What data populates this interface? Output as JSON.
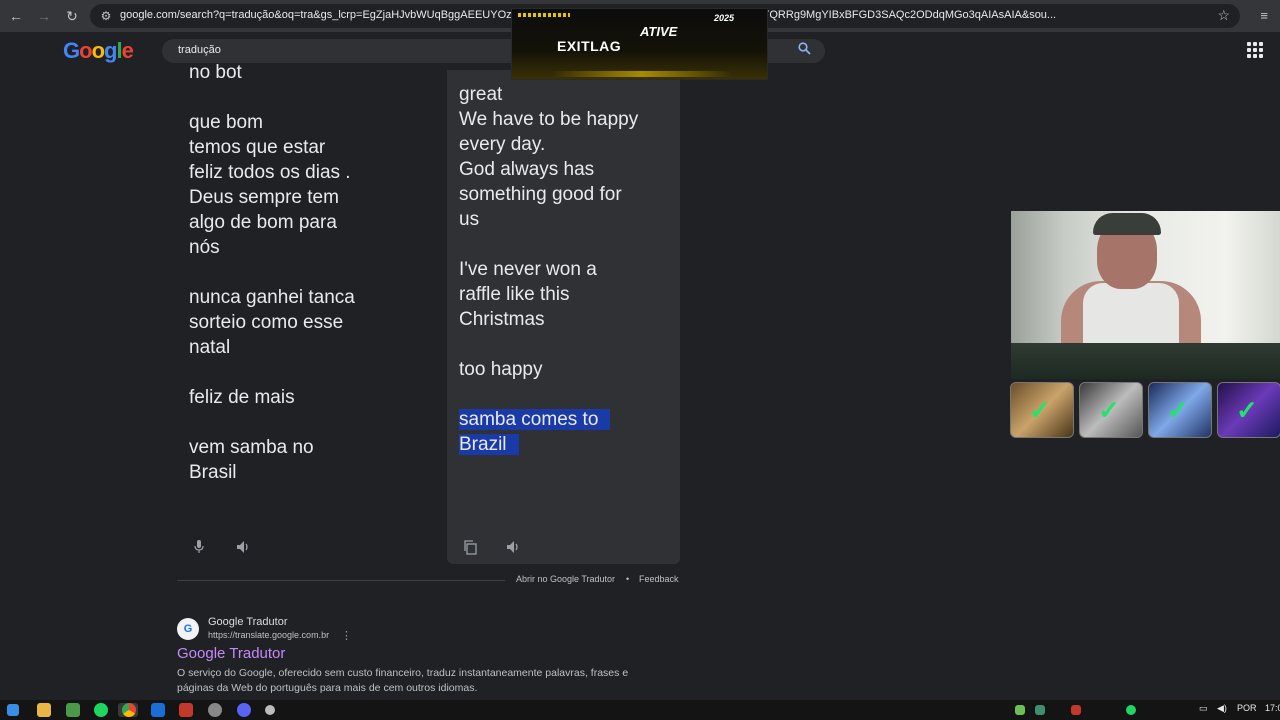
{
  "browser": {
    "url": "google.com/search?q=tradução&oq=tra&gs_lcrp=EgZjaHJvbWUqBggAEEUYOzIGCAEQRRg5MgYIBBBFGDsyBggFEEUYPDIGCAYQRRg9MgYIBxBFGD3SAQc2ODdqMGo3qAIAsAIA&sou..."
  },
  "google": {
    "logo_letters": [
      "G",
      "o",
      "o",
      "g",
      "l",
      "e"
    ],
    "search_query": "tradução"
  },
  "overlay": {
    "brand": "EXITLAG",
    "promo": "ATIVE",
    "year": "2025"
  },
  "translator": {
    "source_lines": [
      "no bot",
      "",
      "que bom",
      "temos que estar",
      "feliz todos os dias .",
      "Deus sempre tem",
      "algo de bom para",
      "nós",
      "",
      "nunca ganhei tanca",
      "sorteio como esse",
      "natal",
      "",
      "feliz de mais",
      "",
      "vem samba no",
      "Brasil"
    ],
    "target_lines": [
      "great",
      "We have to be happy",
      "every day.",
      "God always has",
      "something good for",
      "us",
      "",
      "I've never won a",
      "raffle like this",
      "Christmas",
      "",
      "too happy",
      "",
      "samba comes to",
      "Brazil"
    ],
    "selected_from_index": 13,
    "open_link": "Abrir no Google Tradutor",
    "separator": "•",
    "feedback": "Feedback"
  },
  "result": {
    "site_name": "Google Tradutor",
    "url": "https://translate.google.com.br",
    "title": "Google Tradutor",
    "description": "O serviço do Google, oferecido sem custo financeiro, traduz instantaneamente palavras, frases e páginas da Web do português para mais de cem outros idiomas."
  },
  "taskbar": {
    "language": "POR",
    "clock": "17:0"
  },
  "colors": {
    "page_bg": "#202124",
    "selection": "#1a3aa8",
    "result_title": "#c58af9",
    "check": "#22e36b"
  }
}
